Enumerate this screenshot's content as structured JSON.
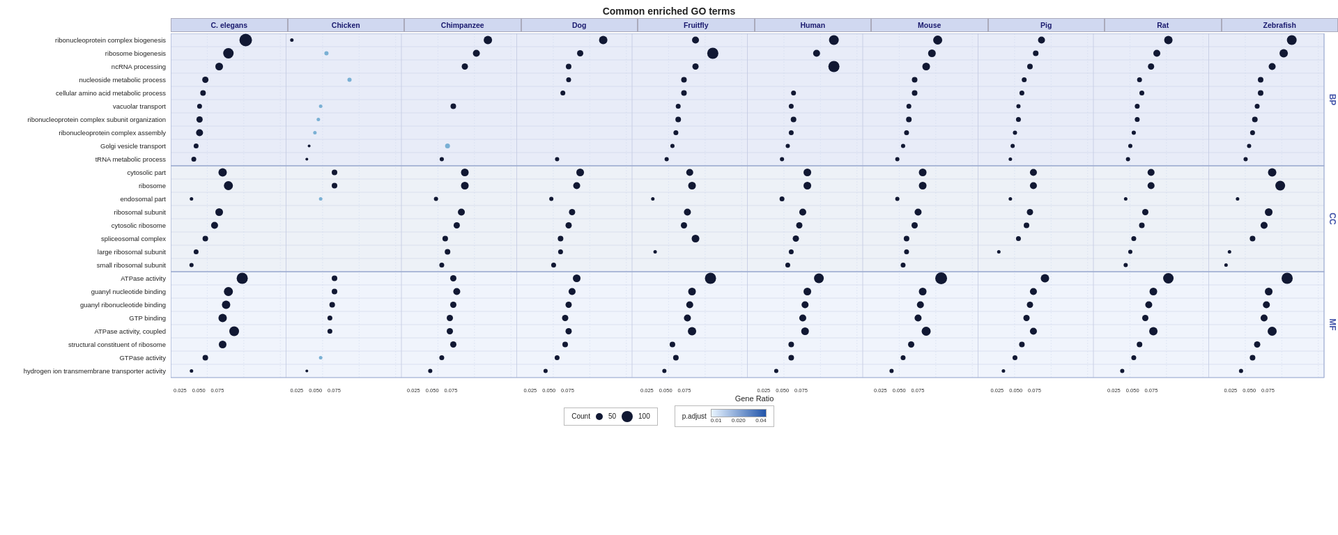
{
  "title": "Common enriched GO terms",
  "columns": [
    "C. elegans",
    "Chicken",
    "Chimpanzee",
    "Dog",
    "Fruitfly",
    "Human",
    "Mouse",
    "Pig",
    "Rat",
    "Zebrafish"
  ],
  "sections": {
    "BP": {
      "label": "BP",
      "rows": [
        "ribonucleoprotein complex biogenesis",
        "ribosome biogenesis",
        "ncRNA processing",
        "nucleoside metabolic process",
        "cellular amino acid metabolic process",
        "vacuolar transport",
        "ribonucleoprotein complex subunit organization",
        "ribonucleoprotein complex assembly",
        "Golgi vesicle transport",
        "tRNA metabolic process"
      ]
    },
    "CC": {
      "label": "CC",
      "rows": [
        "cytosolic part",
        "ribosome",
        "endosomal part",
        "ribosomal subunit",
        "cytosolic ribosome",
        "spliceosomal complex",
        "large ribosomal subunit",
        "small ribosomal subunit"
      ]
    },
    "MF": {
      "label": "MF",
      "rows": [
        "ATPase activity",
        "guanyl nucleotide binding",
        "guanyl ribonucleotide binding",
        "GTP binding",
        "ATPase activity, coupled",
        "structural constituent of ribosome",
        "GTPase activity",
        "hydrogen ion transmembrane transporter activity"
      ]
    }
  },
  "x_axis_label": "Gene Ratio",
  "x_ticks": "0.025 0.050 0.075",
  "legend": {
    "count_label": "Count",
    "count_50": "50",
    "count_100": "100",
    "padjust_label": "p.adjust",
    "padjust_min": "0.01",
    "padjust_mid": "0.020",
    "padjust_max": "0.04"
  }
}
